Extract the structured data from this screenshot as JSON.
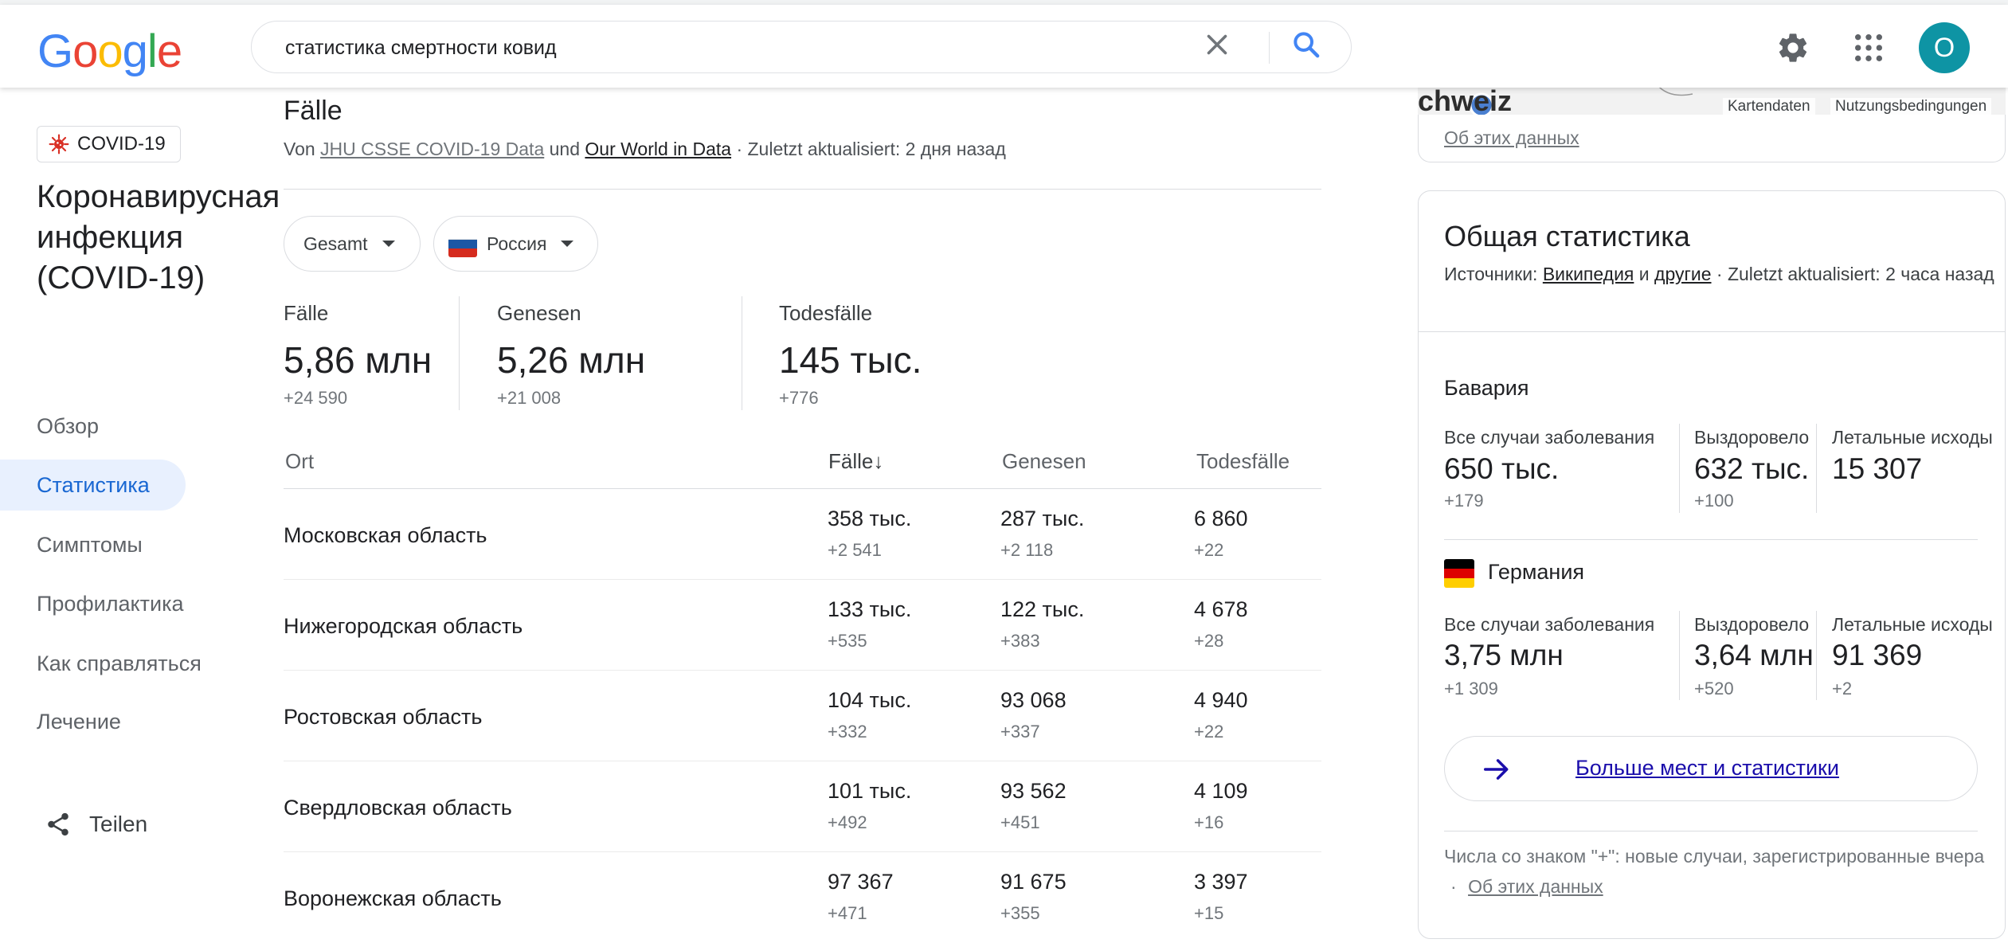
{
  "header": {
    "logo_letters": [
      {
        "ch": "G",
        "color": "#4285f4"
      },
      {
        "ch": "o",
        "color": "#ea4335"
      },
      {
        "ch": "o",
        "color": "#fbbc05"
      },
      {
        "ch": "g",
        "color": "#4285f4"
      },
      {
        "ch": "l",
        "color": "#34a853"
      },
      {
        "ch": "e",
        "color": "#ea4335"
      }
    ],
    "search_query": "статистика смертности ковид",
    "avatar_letter": "O",
    "icons": {
      "clear": "close-icon",
      "search": "search-icon",
      "settings": "gear-icon",
      "apps": "apps-grid-icon"
    }
  },
  "sidebar": {
    "chip_label": "COVID-19",
    "topic_title": "Коронавирусная инфекция (COVID-19)",
    "items": [
      {
        "label": "Обзор",
        "active": false
      },
      {
        "label": "Статистика",
        "active": true
      },
      {
        "label": "Симптомы",
        "active": false
      },
      {
        "label": "Профилактика",
        "active": false
      },
      {
        "label": "Как справляться",
        "active": false
      },
      {
        "label": "Лечение",
        "active": false
      }
    ],
    "share_label": "Teilen"
  },
  "main": {
    "heading": "Fälle",
    "source": {
      "prefix": "Von",
      "link1": "JHU CSSE COVID-19 Data",
      "conj": "und",
      "link2": "Our World in Data",
      "updated": "· Zuletzt aktualisiert: 2 дня назад"
    },
    "filters": {
      "period": "Gesamt",
      "country": "Россия"
    },
    "summary": [
      {
        "label": "Fälle",
        "value": "5,86 млн",
        "delta": "+24 590"
      },
      {
        "label": "Genesen",
        "value": "5,26 млн",
        "delta": "+21 008"
      },
      {
        "label": "Todesfälle",
        "value": "145 тыс.",
        "delta": "+776"
      }
    ],
    "table": {
      "headers": {
        "place": "Ort",
        "cases": "Fälle",
        "recovered": "Genesen",
        "deaths": "Todesfälle"
      },
      "sort_indicator": "↓",
      "rows": [
        {
          "name": "Московская область",
          "cases": "358 тыс.",
          "cases_delta": "+2 541",
          "recovered": "287 тыс.",
          "recovered_delta": "+2 118",
          "deaths": "6 860",
          "deaths_delta": "+22"
        },
        {
          "name": "Нижегородская область",
          "cases": "133 тыс.",
          "cases_delta": "+535",
          "recovered": "122 тыс.",
          "recovered_delta": "+383",
          "deaths": "4 678",
          "deaths_delta": "+28"
        },
        {
          "name": "Ростовская область",
          "cases": "104 тыс.",
          "cases_delta": "+332",
          "recovered": "93 068",
          "recovered_delta": "+337",
          "deaths": "4 940",
          "deaths_delta": "+22"
        },
        {
          "name": "Свердловская область",
          "cases": "101 тыс.",
          "cases_delta": "+492",
          "recovered": "93 562",
          "recovered_delta": "+451",
          "deaths": "4 109",
          "deaths_delta": "+16"
        },
        {
          "name": "Воронежская область",
          "cases": "97 367",
          "cases_delta": "+471",
          "recovered": "91 675",
          "recovered_delta": "+355",
          "deaths": "3 397",
          "deaths_delta": "+15"
        }
      ]
    }
  },
  "map_card": {
    "map_label": "chweiz",
    "attr1": "Kartendaten",
    "attr2": "Nutzungsbedingungen",
    "about_link": "Об этих данных"
  },
  "stats_card": {
    "title": "Общая статистика",
    "source_prefix": "Источники:",
    "link1": "Википедия",
    "conj": "и",
    "link2": "другие",
    "updated": "· Zuletzt aktualisiert: 2 часа назад",
    "regions": [
      {
        "name": "Бавария",
        "has_flag": false,
        "stats": [
          {
            "label": "Все случаи заболевания",
            "value": "650 тыс.",
            "delta": "+179"
          },
          {
            "label": "Выздоровело",
            "value": "632 тыс.",
            "delta": "+100"
          },
          {
            "label": "Летальные исходы",
            "value": "15 307",
            "delta": ""
          }
        ]
      },
      {
        "name": "Германия",
        "has_flag": true,
        "stats": [
          {
            "label": "Все случаи заболевания",
            "value": "3,75 млн",
            "delta": "+1 309"
          },
          {
            "label": "Выздоровело",
            "value": "3,64 млн",
            "delta": "+520"
          },
          {
            "label": "Летальные исходы",
            "value": "91 369",
            "delta": "+2"
          }
        ]
      }
    ],
    "more_button": "Больше мест и статистики",
    "footnote": "Числа со знаком \"+\": новые случаи, зарегистрированные вчера",
    "footnote_sep": "·",
    "footnote_link": "Об этих данных"
  },
  "colors": {
    "accent": "#1967d2",
    "nav_active_bg": "#e8f0fe",
    "avatar": "#0e94a4",
    "covid_icon": "#d93025",
    "link": "#1a0dab"
  }
}
